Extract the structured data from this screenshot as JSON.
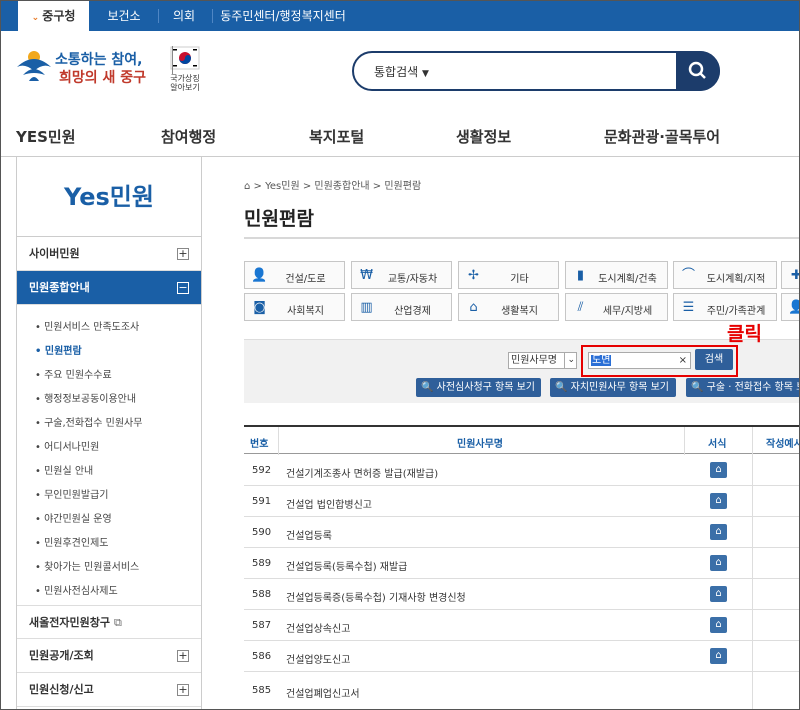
{
  "topbar": {
    "tabs": [
      {
        "label": "중구청",
        "active": true
      },
      {
        "label": "보건소"
      },
      {
        "label": "의회"
      },
      {
        "label": "동주민센터/행정복지센터"
      }
    ]
  },
  "header": {
    "logo_text_1": "소통하는 참여,",
    "logo_text_2": "희망의 새 중구",
    "emblem_caption_1": "국가상징",
    "emblem_caption_2": "알아보기",
    "search_scope": "통합검색"
  },
  "main_nav": [
    "YES민원",
    "참여행정",
    "복지포털",
    "생활정보",
    "문화관광·골목투어"
  ],
  "sidebar": {
    "title": "Yes민원",
    "menus": [
      {
        "label": "사이버민원",
        "toggle": "+"
      },
      {
        "label": "민원종합안내",
        "toggle": "−",
        "active": true
      }
    ],
    "submenu": [
      "민원서비스 만족도조사",
      "민원편람",
      "주요 민원수수료",
      "행정정보공동이용안내",
      "구술,전화접수 민원사무",
      "어디서나민원",
      "민원실 안내",
      "무인민원발급기",
      "야간민원실 운영",
      "민원후견인제도",
      "찾아가는 민원콜서비스",
      "민원사전심사제도"
    ],
    "current_submenu": "민원편람",
    "bottom_menus": [
      {
        "label": "새올전자민원창구",
        "toggle": "⧉"
      },
      {
        "label": "민원공개/조회",
        "toggle": "+"
      },
      {
        "label": "민원신청/신고",
        "toggle": "+"
      }
    ]
  },
  "breadcrumb": [
    "Yes민원",
    "민원종합안내",
    "민원편람"
  ],
  "page_title": "민원편람",
  "categories": [
    {
      "label": "건설/도로",
      "icon": "person-icon"
    },
    {
      "label": "교통/자동차",
      "icon": "money-icon"
    },
    {
      "label": "기타",
      "icon": "pinwheel-icon"
    },
    {
      "label": "도시계획/건축",
      "icon": "chart-icon"
    },
    {
      "label": "도시계획/지적",
      "icon": "rainbow-icon"
    },
    {
      "label": "사회복지",
      "icon": "camera-icon"
    },
    {
      "label": "산업경제",
      "icon": "building-icon"
    },
    {
      "label": "생활복지",
      "icon": "house-icon"
    },
    {
      "label": "세무/지방세",
      "icon": "rain-icon"
    },
    {
      "label": "주민/가족관계",
      "icon": "list-icon"
    }
  ],
  "filter": {
    "field_select": "민원사무명",
    "keyword": "도면",
    "clear": "×",
    "search_button": "검색",
    "annotation": "클릭",
    "buttons": [
      "사전심사청구 항목 보기",
      "자치민원사무 항목 보기",
      "구술 · 전화접수 항목 보기"
    ]
  },
  "table": {
    "headers": {
      "no": "번호",
      "name": "민원사무명",
      "form": "서식",
      "example": "작성예시"
    },
    "rows": [
      {
        "no": "592",
        "name": "건설기계조종사 면허증 발급(재발급)"
      },
      {
        "no": "591",
        "name": "건설업 법인합병신고"
      },
      {
        "no": "590",
        "name": "건설업등록"
      },
      {
        "no": "589",
        "name": "건설업등록(등록수첩) 재발급"
      },
      {
        "no": "588",
        "name": "건설업등록증(등록수첩) 기재사항 변경신청"
      },
      {
        "no": "587",
        "name": "건설업상속신고"
      },
      {
        "no": "586",
        "name": "건설업양도신고"
      },
      {
        "no": "585",
        "name": "건설업폐업신고서"
      }
    ]
  },
  "colors": {
    "primary": "#1a5fa6",
    "navy": "#1c3c6b",
    "annotation": "#e60000"
  }
}
